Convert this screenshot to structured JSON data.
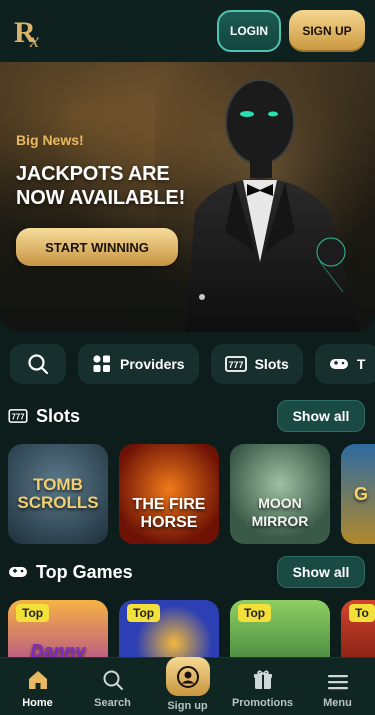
{
  "header": {
    "login_label": "LOGIN",
    "signup_label": "SIGN UP"
  },
  "hero": {
    "kicker": "Big News!",
    "title": "JACKPOTS ARE NOW AVAILABLE!",
    "cta_label": "START WINNING"
  },
  "filters": {
    "items": [
      {
        "label": "Providers",
        "icon": "grid-icon"
      },
      {
        "label": "Slots",
        "icon": "slot-machine-icon"
      },
      {
        "label": "T",
        "icon": "gamepad-icon"
      }
    ]
  },
  "slots": {
    "title": "Slots",
    "show_all": "Show all",
    "games": [
      {
        "name": "TOMB SCROLLS"
      },
      {
        "name": "THE FIRE HORSE"
      },
      {
        "name": "MOON MIRROR"
      },
      {
        "name": "G"
      }
    ]
  },
  "top_games": {
    "title": "Top Games",
    "show_all": "Show all",
    "games": [
      {
        "tag": "Top",
        "name": "Danny"
      },
      {
        "tag": "Top",
        "name": ""
      },
      {
        "tag": "Top",
        "name": ""
      },
      {
        "tag": "To",
        "name": ""
      }
    ]
  },
  "bottom_nav": {
    "items": [
      {
        "label": "Home",
        "icon": "home-icon"
      },
      {
        "label": "Search",
        "icon": "search-icon"
      },
      {
        "label": "Sign up",
        "icon": "user-icon"
      },
      {
        "label": "Promotions",
        "icon": "gift-icon"
      },
      {
        "label": "Menu",
        "icon": "menu-icon"
      }
    ]
  },
  "colors": {
    "accent_gold": "#e9b961",
    "teal": "#1a4a44",
    "background": "#0d1d1b"
  }
}
